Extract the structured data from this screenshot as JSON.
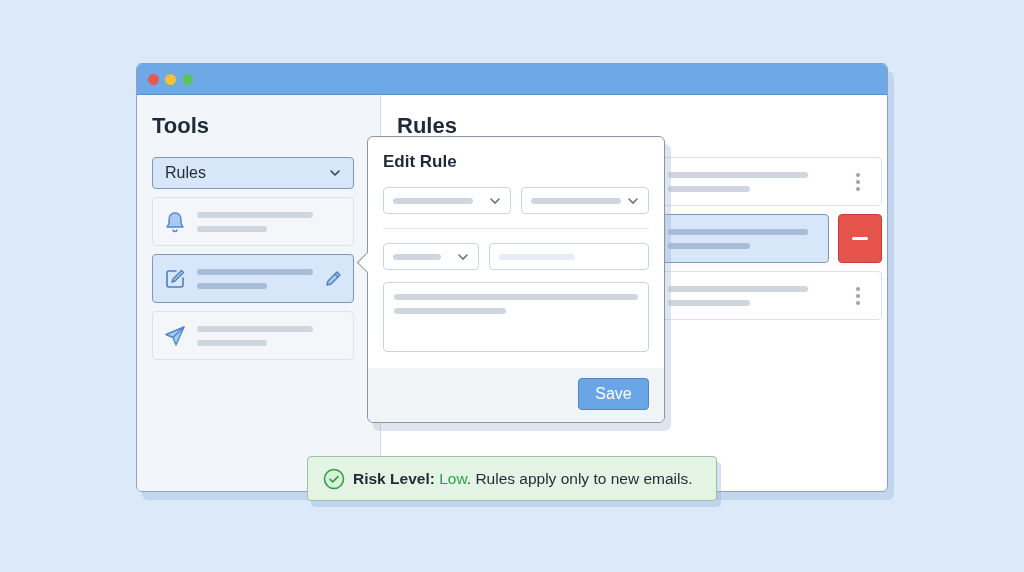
{
  "window": {
    "controls": [
      {
        "color": "#e8584f"
      },
      {
        "color": "#f2c23c"
      },
      {
        "color": "#5cc25a"
      }
    ]
  },
  "sidebar": {
    "title": "Tools",
    "dropdown": {
      "value": "Rules"
    },
    "items": [
      {
        "kind": "bell",
        "selected": false
      },
      {
        "kind": "edit",
        "selected": true
      },
      {
        "kind": "send",
        "selected": false
      }
    ]
  },
  "main": {
    "title": "Rules",
    "rules": [
      {
        "selected": false
      },
      {
        "selected": true
      },
      {
        "selected": false
      }
    ]
  },
  "popup": {
    "title": "Edit Rule",
    "button": "Save"
  },
  "notice": {
    "label": "Risk Level:",
    "level_text": "Low",
    "message": ". Rules apply only to new emails."
  }
}
